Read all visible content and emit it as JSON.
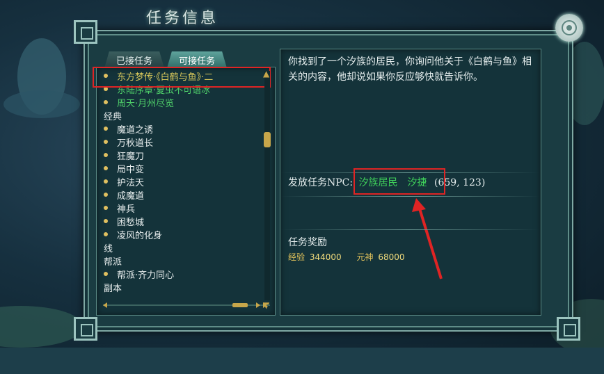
{
  "window": {
    "title": "任务信息"
  },
  "tabs": [
    {
      "label": "已接任务",
      "active": false
    },
    {
      "label": "可接任务",
      "active": true
    }
  ],
  "quest_list": [
    {
      "text": "东方梦传·《白鹤与鱼》·二",
      "bullet": true,
      "color": "selected"
    },
    {
      "text": "东陆序章·夏虫不可语冰",
      "bullet": true,
      "color": "green"
    },
    {
      "text": "周天·月州尽览",
      "bullet": true,
      "color": "green"
    },
    {
      "text": "经典",
      "bullet": false,
      "color": "white"
    },
    {
      "text": "魔道之诱",
      "bullet": true,
      "color": "white"
    },
    {
      "text": "万秋道长",
      "bullet": true,
      "color": "white"
    },
    {
      "text": "狂魔刀",
      "bullet": true,
      "color": "white"
    },
    {
      "text": "局中变",
      "bullet": true,
      "color": "white"
    },
    {
      "text": "护法天",
      "bullet": true,
      "color": "white"
    },
    {
      "text": "成魔道",
      "bullet": true,
      "color": "white"
    },
    {
      "text": "神兵",
      "bullet": true,
      "color": "white"
    },
    {
      "text": "困愁城",
      "bullet": true,
      "color": "white"
    },
    {
      "text": "凌风的化身",
      "bullet": true,
      "color": "white"
    },
    {
      "text": "线",
      "bullet": false,
      "color": "white"
    },
    {
      "text": "帮派",
      "bullet": false,
      "color": "white"
    },
    {
      "text": "帮派·齐力同心",
      "bullet": true,
      "color": "white"
    },
    {
      "text": "副本",
      "bullet": false,
      "color": "white"
    }
  ],
  "detail": {
    "description": "你找到了一个汐族的居民，你询问他关于《白鹤与鱼》相关的内容，他却说如果你反应够快就告诉你。",
    "npc_label": "发放任务NPC:",
    "npc_name": "汐族居民　汐捷",
    "npc_coords": "(659, 123)",
    "reward_title": "任务奖励",
    "rewards": [
      {
        "label": "经验",
        "value": "344000"
      },
      {
        "label": "元神",
        "value": "68000"
      }
    ]
  },
  "colors": {
    "accent_green": "#4fd06a",
    "highlight_red": "#e02424",
    "gold": "#e2c25a"
  }
}
